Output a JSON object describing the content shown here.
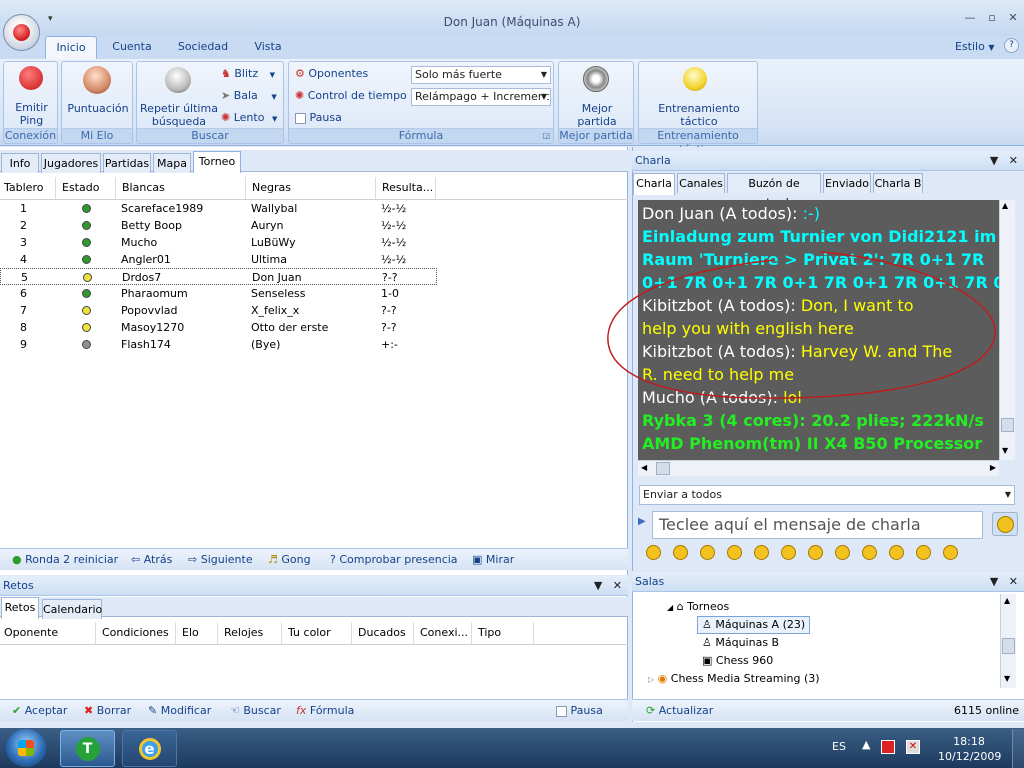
{
  "window": {
    "title": "Don Juan (Máquinas A)",
    "quick_access": "▾"
  },
  "ribbon": {
    "tabs": [
      "Inicio",
      "Cuenta",
      "Sociedad",
      "Vista"
    ],
    "estilo": "Estilo",
    "groups": {
      "conexion": {
        "caption": "Conexión",
        "button": [
          "Emitir",
          "Ping"
        ]
      },
      "mielo": {
        "caption": "Mi Elo",
        "button": "Puntuación"
      },
      "buscar": {
        "caption": "Buscar",
        "big": [
          "Repetir última",
          "búsqueda"
        ],
        "small": [
          "Blitz",
          "Bala",
          "Lento"
        ]
      },
      "formula": {
        "caption": "Fórmula",
        "items": [
          "Oponentes",
          "Control de tiempo",
          "Pausa"
        ],
        "combo1": "Solo más fuerte",
        "combo2": "Relámpago + Increment"
      },
      "mejor": {
        "caption": "Mejor partida",
        "button": [
          "Mejor",
          "partida"
        ]
      },
      "entrenamiento": {
        "caption": "Entrenamiento táctico",
        "button": [
          "Entrenamiento",
          "táctico"
        ]
      }
    }
  },
  "left": {
    "tabs": [
      "Info",
      "Jugadores",
      "Partidas",
      "Mapa",
      "Torneo"
    ],
    "columns": [
      "Tablero",
      "Estado",
      "Blancas",
      "Negras",
      "Resulta..."
    ],
    "rows": [
      {
        "n": "1",
        "color": "#2e9a2e",
        "w": "Scareface1989",
        "b": "Wallybal",
        "r": "½-½"
      },
      {
        "n": "2",
        "color": "#2e9a2e",
        "w": "Betty Boop",
        "b": "Auryn",
        "r": "½-½"
      },
      {
        "n": "3",
        "color": "#2e9a2e",
        "w": "Mucho",
        "b": "LuBüWy",
        "r": "½-½"
      },
      {
        "n": "4",
        "color": "#2e9a2e",
        "w": "Angler01",
        "b": "Ultima",
        "r": "½-½"
      },
      {
        "n": "5",
        "color": "#f0e23a",
        "w": "Drdos7",
        "b": "Don Juan",
        "r": "?-?"
      },
      {
        "n": "6",
        "color": "#2e9a2e",
        "w": "Pharaomum",
        "b": "Senseless",
        "r": "1-0"
      },
      {
        "n": "7",
        "color": "#f0e23a",
        "w": "Popovvlad",
        "b": "X_felix_x",
        "r": "?-?"
      },
      {
        "n": "8",
        "color": "#f0e23a",
        "w": "Masoy1270",
        "b": "Otto der erste",
        "r": "?-?"
      },
      {
        "n": "9",
        "color": "#909090",
        "w": "Flash174",
        "b": "(Bye)",
        "r": "+:-"
      }
    ],
    "toolbar": [
      "Ronda 2 reiniciar",
      "Atrás",
      "Siguiente",
      "Gong",
      "Comprobar presencia",
      "Mirar"
    ]
  },
  "retos": {
    "title": "Retos",
    "tabs": [
      "Retos",
      "Calendario"
    ],
    "columns": [
      "Oponente",
      "Condiciones",
      "Elo",
      "Relojes",
      "Tu color",
      "Ducados",
      "Conexi...",
      "Tipo"
    ],
    "toolbar": [
      "Aceptar",
      "Borrar",
      "Modificar",
      "Buscar",
      "Fórmula"
    ],
    "pausa": "Pausa"
  },
  "charla": {
    "title": "Charla",
    "tabs": [
      "Charla",
      "Canales",
      "Buzón de entrada",
      "Enviado",
      "Charla B"
    ],
    "lines": [
      {
        "a": "Don Juan (A todos):  ",
        "b": ":-)",
        "ca": "#ffffff",
        "cb": "#00ffff"
      },
      {
        "a": "Einladung zum Turnier von Didi2121 im",
        "b": "",
        "ca": "#00ffff",
        "cb": "#00ffff"
      },
      {
        "a": "Raum 'Turniere > Privat 2': 7R 0+1 7R",
        "b": "",
        "ca": "#00ffff",
        "cb": "#00ffff"
      },
      {
        "a": "0+1 7R 0+1 7R 0+1 7R 0+1 7R 0+1 7R 0+1",
        "b": "",
        "ca": "#00ffff",
        "cb": "#00ffff"
      },
      {
        "a": "Kibitzbot (A todos):  ",
        "b": "Don, I want to",
        "ca": "#ffffff",
        "cb": "#ffff00"
      },
      {
        "a": "help you with english here",
        "b": "",
        "ca": "#ffff00",
        "cb": "#ffff00"
      },
      {
        "a": "Kibitzbot (A todos):  ",
        "b": "Harvey W. and The",
        "ca": "#ffffff",
        "cb": "#ffff00"
      },
      {
        "a": "R. need to help me",
        "b": "",
        "ca": "#ffff00",
        "cb": "#ffff00"
      },
      {
        "a": "Mucho (A todos):  ",
        "b": "lol",
        "ca": "#ffffff",
        "cb": "#ffff00"
      },
      {
        "a": "Rybka 3 (4 cores): 20.2 plies; 222kN/s",
        "b": "",
        "ca": "#22ee22",
        "cb": "#22ee22"
      },
      {
        "a": "AMD Phenom(tm) II X4 B50 Processor",
        "b": "",
        "ca": "#22ee22",
        "cb": "#22ee22"
      }
    ],
    "send_to": "Enviar a todos",
    "placeholder": "Teclee aquí el mensaje de charla"
  },
  "salas": {
    "title": "Salas",
    "items": [
      "Torneos",
      "Máquinas A  (23)",
      "Máquinas B",
      "Chess 960",
      "Chess Media Streaming  (3)"
    ],
    "actualizar": "Actualizar",
    "online": "6115 online"
  },
  "taskbar": {
    "lang": "ES",
    "time": "18:18",
    "date": "10/12/2009"
  }
}
